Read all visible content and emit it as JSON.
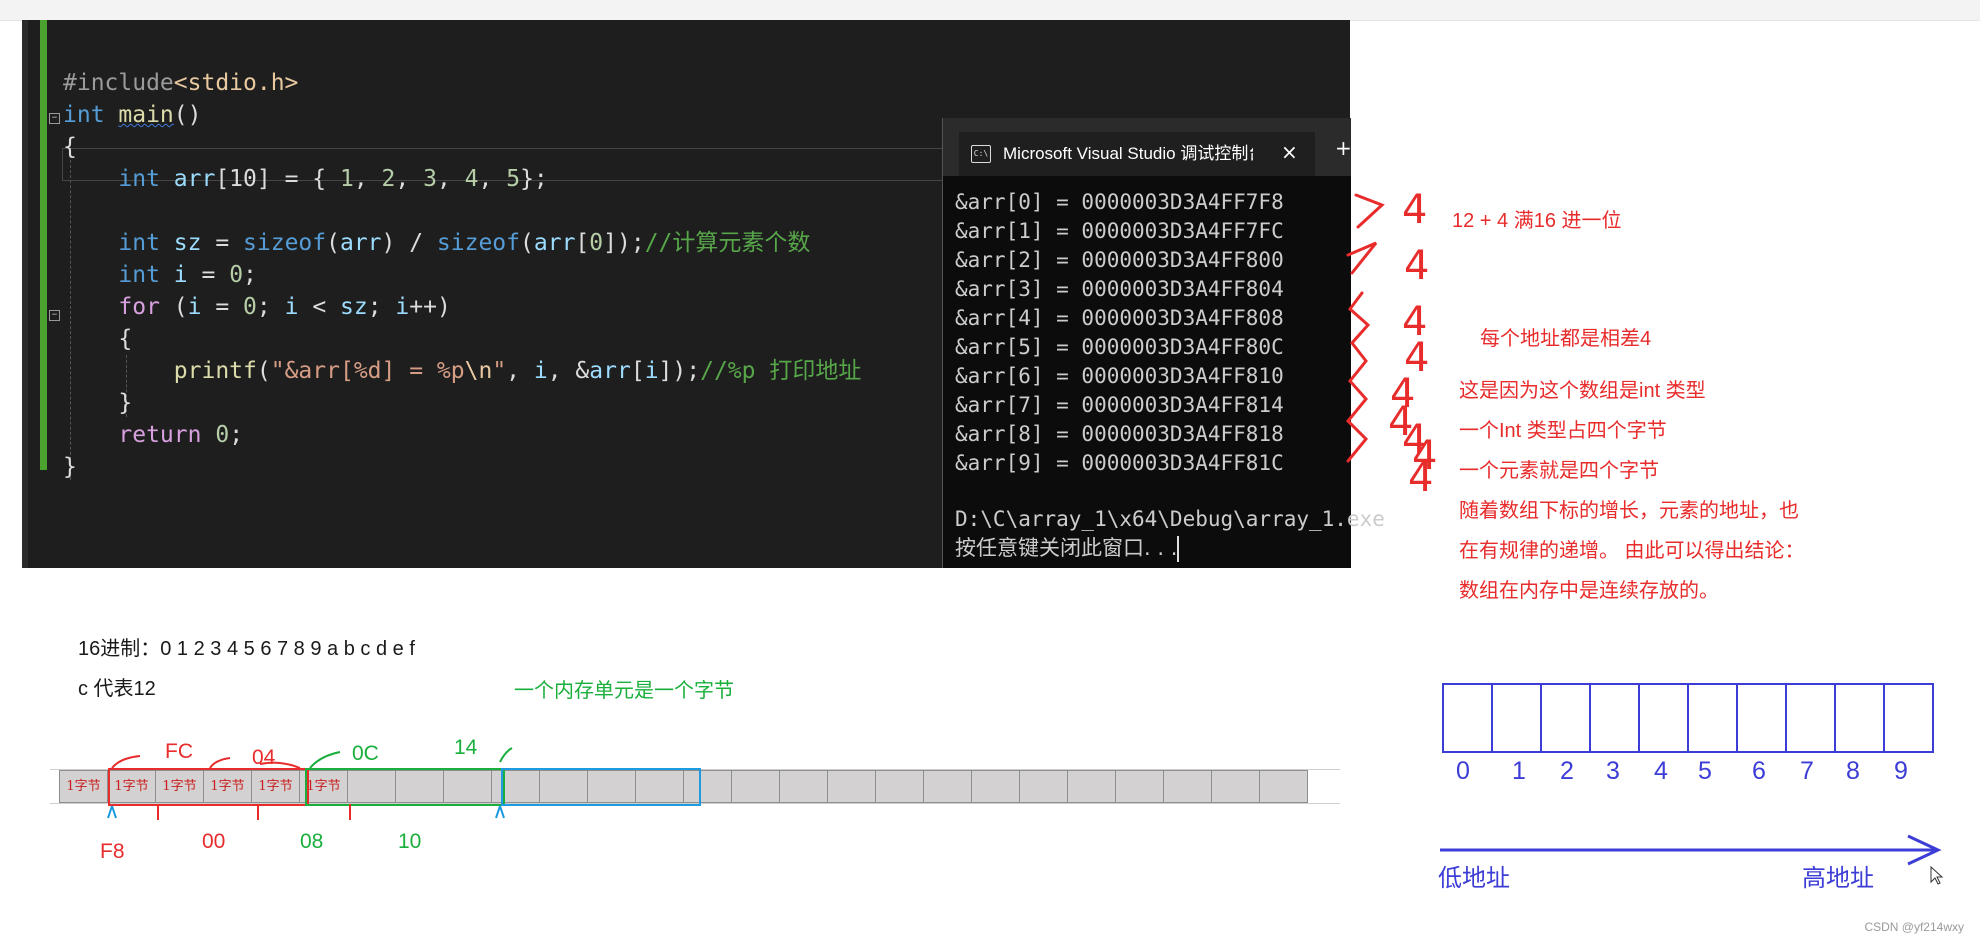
{
  "code_lines": [
    {
      "parts": [
        {
          "t": "#include",
          "c": "pp"
        },
        {
          "t": "<stdio.h>",
          "c": "inc"
        }
      ]
    },
    {
      "parts": [
        {
          "t": "int ",
          "c": "kw"
        },
        {
          "t": "main",
          "c": "fn squig"
        },
        {
          "t": "()",
          "c": "plain"
        }
      ]
    },
    {
      "parts": [
        {
          "t": "{",
          "c": "plain"
        }
      ]
    },
    {
      "parts": [
        {
          "t": "    ",
          "c": "plain"
        },
        {
          "t": "int ",
          "c": "kw"
        },
        {
          "t": "arr",
          "c": "var"
        },
        {
          "t": "[10] = { ",
          "c": "plain"
        },
        {
          "t": "1",
          "c": "num"
        },
        {
          "t": ", ",
          "c": "plain"
        },
        {
          "t": "2",
          "c": "num"
        },
        {
          "t": ", ",
          "c": "plain"
        },
        {
          "t": "3",
          "c": "num"
        },
        {
          "t": ", ",
          "c": "plain"
        },
        {
          "t": "4",
          "c": "num"
        },
        {
          "t": ", ",
          "c": "plain"
        },
        {
          "t": "5",
          "c": "num"
        },
        {
          "t": "};",
          "c": "plain"
        }
      ]
    },
    {
      "parts": []
    },
    {
      "parts": [
        {
          "t": "    ",
          "c": "plain"
        },
        {
          "t": "int ",
          "c": "kw"
        },
        {
          "t": "sz",
          "c": "var"
        },
        {
          "t": " = ",
          "c": "plain"
        },
        {
          "t": "sizeof",
          "c": "kw"
        },
        {
          "t": "(",
          "c": "plain"
        },
        {
          "t": "arr",
          "c": "var"
        },
        {
          "t": ") / ",
          "c": "plain"
        },
        {
          "t": "sizeof",
          "c": "kw"
        },
        {
          "t": "(",
          "c": "plain"
        },
        {
          "t": "arr",
          "c": "var"
        },
        {
          "t": "[",
          "c": "plain"
        },
        {
          "t": "0",
          "c": "num"
        },
        {
          "t": "]);",
          "c": "plain"
        },
        {
          "t": "//计算元素个数",
          "c": "cm"
        }
      ]
    },
    {
      "parts": [
        {
          "t": "    ",
          "c": "plain"
        },
        {
          "t": "int ",
          "c": "kw"
        },
        {
          "t": "i",
          "c": "var"
        },
        {
          "t": " = ",
          "c": "plain"
        },
        {
          "t": "0",
          "c": "num"
        },
        {
          "t": ";",
          "c": "plain"
        }
      ]
    },
    {
      "parts": [
        {
          "t": "    ",
          "c": "plain"
        },
        {
          "t": "for",
          "c": "ctl"
        },
        {
          "t": " (",
          "c": "plain"
        },
        {
          "t": "i",
          "c": "var"
        },
        {
          "t": " = ",
          "c": "plain"
        },
        {
          "t": "0",
          "c": "num"
        },
        {
          "t": "; ",
          "c": "plain"
        },
        {
          "t": "i",
          "c": "var"
        },
        {
          "t": " < ",
          "c": "plain"
        },
        {
          "t": "sz",
          "c": "var"
        },
        {
          "t": "; ",
          "c": "plain"
        },
        {
          "t": "i",
          "c": "var"
        },
        {
          "t": "++)",
          "c": "plain"
        }
      ]
    },
    {
      "parts": [
        {
          "t": "    {",
          "c": "plain"
        }
      ]
    },
    {
      "parts": [
        {
          "t": "        ",
          "c": "plain"
        },
        {
          "t": "printf",
          "c": "fn"
        },
        {
          "t": "(",
          "c": "plain"
        },
        {
          "t": "\"&arr[%d] = %p",
          "c": "str"
        },
        {
          "t": "\\n",
          "c": "esc"
        },
        {
          "t": "\"",
          "c": "str"
        },
        {
          "t": ", ",
          "c": "plain"
        },
        {
          "t": "i",
          "c": "var"
        },
        {
          "t": ", &",
          "c": "plain"
        },
        {
          "t": "arr",
          "c": "var"
        },
        {
          "t": "[",
          "c": "plain"
        },
        {
          "t": "i",
          "c": "var"
        },
        {
          "t": "]);",
          "c": "plain"
        },
        {
          "t": "//%p 打印地址",
          "c": "cm"
        }
      ]
    },
    {
      "parts": [
        {
          "t": "    }",
          "c": "plain"
        }
      ]
    },
    {
      "parts": [
        {
          "t": "    ",
          "c": "plain"
        },
        {
          "t": "return ",
          "c": "ctl"
        },
        {
          "t": "0",
          "c": "num"
        },
        {
          "t": ";",
          "c": "plain"
        }
      ]
    },
    {
      "parts": [
        {
          "t": "}",
          "c": "plain"
        }
      ]
    }
  ],
  "console": {
    "title": "Microsoft Visual Studio 调试控制台",
    "close": "×",
    "plus": "+",
    "lines": [
      "&arr[0] = 0000003D3A4FF7F8",
      "&arr[1] = 0000003D3A4FF7FC",
      "&arr[2] = 0000003D3A4FF800",
      "&arr[3] = 0000003D3A4FF804",
      "&arr[4] = 0000003D3A4FF808",
      "&arr[5] = 0000003D3A4FF80C",
      "&arr[6] = 0000003D3A4FF810",
      "&arr[7] = 0000003D3A4FF814",
      "&arr[8] = 0000003D3A4FF818",
      "&arr[9] = 0000003D3A4FF81C"
    ],
    "path": "D:\\C\\array_1\\x64\\Debug\\array_1.exe",
    "press_key": "按任意键关闭此窗口. . ."
  },
  "handwritten_fours": [
    "4",
    "4",
    "4",
    "4",
    "4",
    "4",
    "4",
    "4",
    "4"
  ],
  "notes": {
    "carry": "12  + 4 满16 进一位",
    "diff": "每个地址都是相差4",
    "explain": [
      "这是因为这个数组是int 类型",
      "一个Int 类型占四个字节",
      "一个元素就是四个字节",
      "随着数组下标的增长，元素的地址，也",
      "在有规律的递增。 由此可以得出结论：",
      "数组在内存中是连续存放的。"
    ],
    "hex": "16进制：0 1 2 3 4 5 6 7 8 9 a b c d e f",
    "c_is_12": "c 代表12",
    "unit": "一个内存单元是一个字节"
  },
  "memory": {
    "byte_label": "1字节",
    "top_labels": [
      "FC",
      "04",
      "0C",
      "14"
    ],
    "bottom_labels": [
      "F8",
      "00",
      "08",
      "10"
    ],
    "cell_count": 26,
    "labeled_cells": 6
  },
  "array_diagram": {
    "indices": [
      "0",
      "1",
      "2",
      "3",
      "4",
      "5",
      "6",
      "7",
      "8",
      "9"
    ],
    "low": "低地址",
    "high": "高地址"
  },
  "footer": "CSDN @yf214wxy",
  "colors": {
    "editor_bg": "#1e1e1e",
    "console_bg": "#0c0c0c",
    "annotation_red": "#e82b2b",
    "annotation_green": "#1aaf3c",
    "annotation_blue": "#3c3cd6",
    "cyan_box": "#1e9be0"
  }
}
